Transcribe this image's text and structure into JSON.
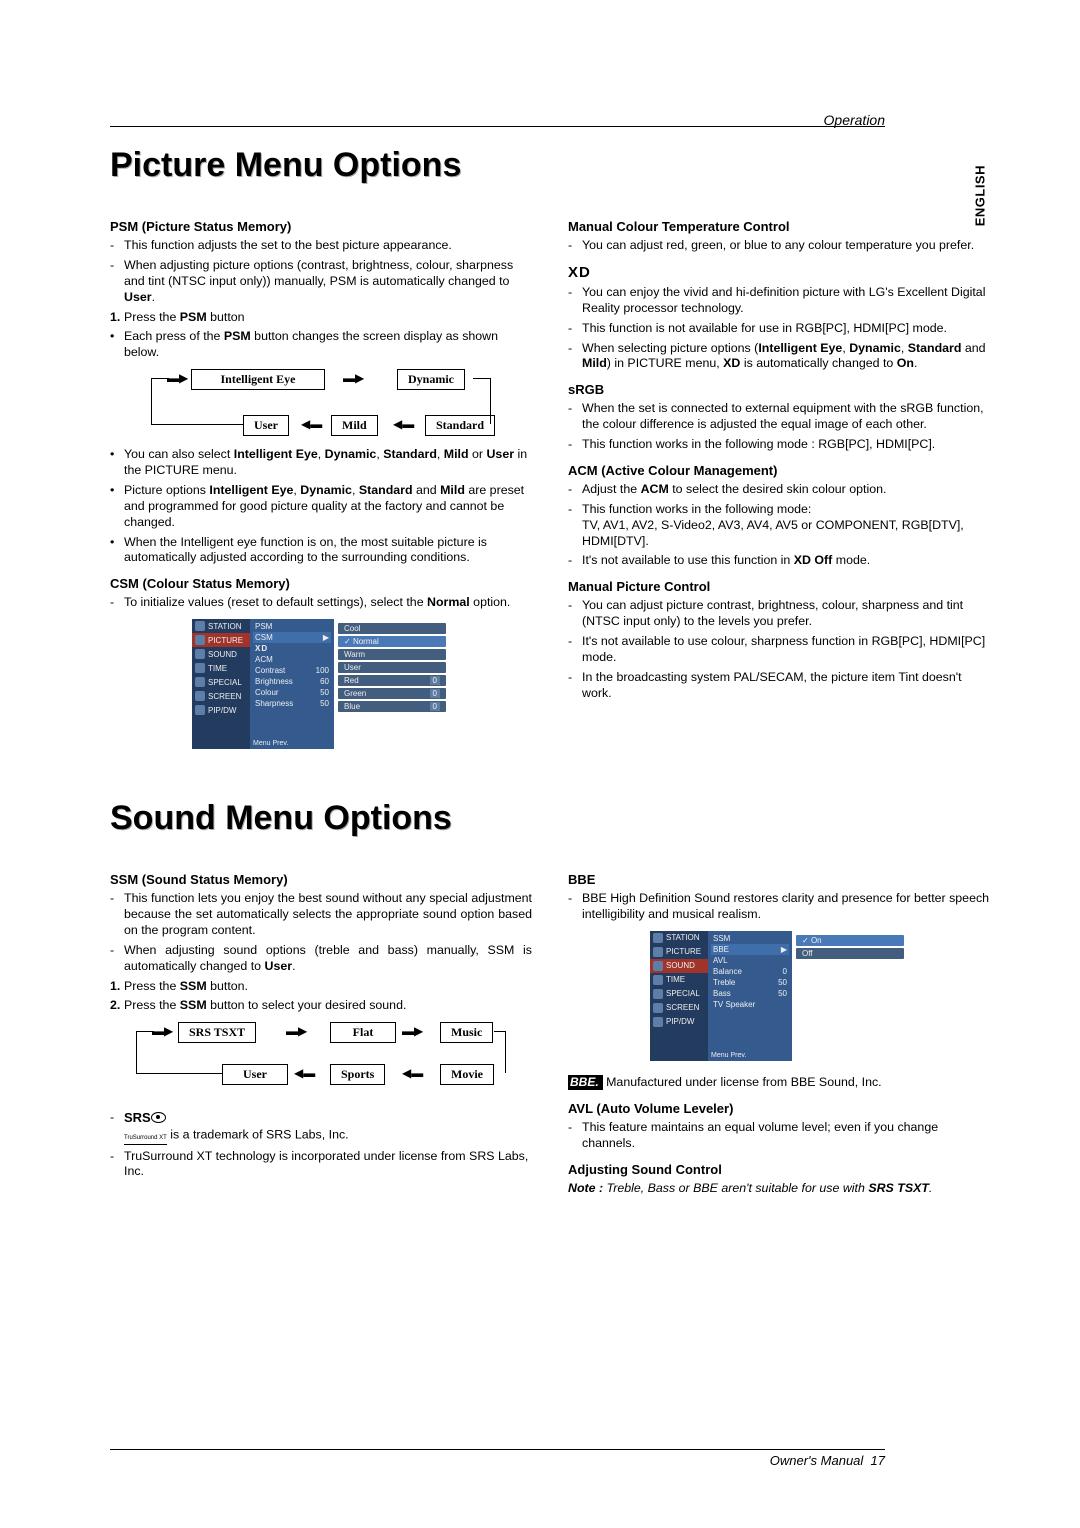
{
  "header": {
    "operation": "Operation",
    "lang": "ENGLISH"
  },
  "titles": {
    "picture": "Picture Menu Options",
    "sound": "Sound Menu Options"
  },
  "picture_left": {
    "psm_h": "PSM (Picture Status Memory)",
    "psm_b1": "This function adjusts the set to the best picture appearance.",
    "psm_b2a": "When adjusting picture options (contrast, brightness, colour, sharpness and tint (NTSC input only)) manually, PSM is automatically changed to ",
    "psm_b2b": "User",
    "psm_b2c": ".",
    "psm_step1a": "Press the ",
    "psm_step1b": "PSM",
    "psm_step1c": " button",
    "psm_step2a": "Each press of the ",
    "psm_step2b": "PSM",
    "psm_step2c": " button changes the screen display as shown below.",
    "psm_flow": {
      "a": "Intelligent Eye",
      "b": "Dynamic",
      "c": "Standard",
      "d": "Mild",
      "e": "User"
    },
    "psm_foot1a": "You can also select ",
    "psm_foot1b": "Intelligent Eye",
    "psm_foot1c": ", ",
    "psm_foot1d": "Dynamic",
    "psm_foot1e": ", ",
    "psm_foot1f": "Standard",
    "psm_foot1g": ", ",
    "psm_foot1h": "Mild",
    "psm_foot1i": " or ",
    "psm_foot1j": "User",
    "psm_foot1k": " in the PICTURE menu.",
    "psm_foot2a": "Picture options ",
    "psm_foot2b": "Intelligent Eye",
    "psm_foot2c": ", ",
    "psm_foot2d": "Dynamic",
    "psm_foot2e": ", ",
    "psm_foot2f": "Standard",
    "psm_foot2g": " and ",
    "psm_foot2h": "Mild",
    "psm_foot2i": " are preset and programmed for good picture quality at the factory and cannot be changed.",
    "psm_foot3": "When the Intelligent eye function is on, the most suitable picture is automatically adjusted according to the surrounding conditions.",
    "csm_h": "CSM (Colour Status Memory)",
    "csm_b1a": "To initialize values (reset to default settings), select the ",
    "csm_b1b": "Normal",
    "csm_b1c": " option.",
    "osd1_left": [
      "STATION",
      "PICTURE",
      "SOUND",
      "TIME",
      "SPECIAL",
      "SCREEN",
      "PIP/DW"
    ],
    "osd1_mid": [
      {
        "k": "PSM",
        "v": ""
      },
      {
        "k": "CSM",
        "v": "▶"
      },
      {
        "k": "XD",
        "v": ""
      },
      {
        "k": "ACM",
        "v": ""
      },
      {
        "k": "Contrast",
        "v": "100"
      },
      {
        "k": "Brightness",
        "v": "60"
      },
      {
        "k": "Colour",
        "v": "50"
      },
      {
        "k": "Sharpness",
        "v": "50"
      }
    ],
    "osd1_btm": "Menu  Prev.",
    "osd1_right": [
      {
        "t": "Cool",
        "v": ""
      },
      {
        "t": "Normal",
        "v": "✓"
      },
      {
        "t": "Warm",
        "v": ""
      },
      {
        "t": "User",
        "v": ""
      },
      {
        "t": "Red",
        "v": "0"
      },
      {
        "t": "Green",
        "v": "0"
      },
      {
        "t": "Blue",
        "v": "0"
      }
    ]
  },
  "picture_right": {
    "mcol_h": "Manual Colour Temperature Control",
    "mcol_b1": "You can adjust red, green, or blue to any colour temperature you prefer.",
    "xd_logo": "XD",
    "xd_b1": "You can enjoy the vivid and hi-definition picture with LG's Excellent Digital Reality processor technology.",
    "xd_b2": "This function is not available for use in RGB[PC], HDMI[PC] mode.",
    "xd_b3a": "When selecting picture options (",
    "xd_b3b": "Intelligent Eye",
    "xd_b3c": ", ",
    "xd_b3d": "Dynamic",
    "xd_b3e": ", ",
    "xd_b3f": "Standard",
    "xd_b3g": " and ",
    "xd_b3h": "Mild",
    "xd_b3i": ") in PICTURE menu, ",
    "xd_b3j": "XD",
    "xd_b3k": " is automatically changed to ",
    "xd_b3l": "On",
    "xd_b3m": ".",
    "srgb_h": "sRGB",
    "srgb_b1": "When the set is connected to external equipment with the sRGB function, the colour difference is adjusted the equal image of each other.",
    "srgb_b2": "This function works in the following mode : RGB[PC], HDMI[PC].",
    "acm_h": "ACM (Active Colour Management)",
    "acm_b1a": "Adjust the ",
    "acm_b1b": "ACM",
    "acm_b1c": " to select the desired skin colour option.",
    "acm_b2": "This function works in the following mode:",
    "acm_b2b": "TV, AV1, AV2, S-Video2, AV3, AV4, AV5 or COMPONENT, RGB[DTV], HDMI[DTV].",
    "acm_b3a": "It's not available to use this function in ",
    "acm_b3b": "XD Off",
    "acm_b3c": " mode.",
    "mpc_h": "Manual Picture Control",
    "mpc_b1": "You can adjust picture contrast, brightness, colour, sharpness and tint (NTSC input only) to the levels you prefer.",
    "mpc_b2": "It's not available to use colour, sharpness function in RGB[PC], HDMI[PC] mode.",
    "mpc_b3": "In the broadcasting system PAL/SECAM, the picture item Tint doesn't work."
  },
  "sound_left": {
    "ssm_h": "SSM (Sound Status Memory)",
    "ssm_b1": "This function lets you enjoy the best sound without any special adjustment because the set automatically selects the appropriate sound option based on the program content.",
    "ssm_b2a": "When adjusting sound options (treble and bass) manually, SSM is automatically changed to ",
    "ssm_b2b": "User",
    "ssm_b2c": ".",
    "ssm_s1a": "Press the ",
    "ssm_s1b": "SSM",
    "ssm_s1c": " button.",
    "ssm_s2a": "Press the ",
    "ssm_s2b": "SSM",
    "ssm_s2c": " button to select your desired sound.",
    "ssm_flow": {
      "a": "SRS TSXT",
      "b": "Flat",
      "c": "Music",
      "d": "Movie",
      "e": "Sports",
      "f": "User"
    },
    "srs_tm": " is a trademark of SRS Labs, Inc.",
    "srs_lic": "TruSurround XT technology is incorporated under license from SRS Labs, Inc.",
    "srs_logo_main": "SRS",
    "srs_logo_sub": "TruSurround XT"
  },
  "sound_right": {
    "bbe_h": "BBE",
    "bbe_b1": "BBE High Definition Sound restores clarity and presence for better speech intelligibility and musical realism.",
    "osd2_left": [
      "STATION",
      "PICTURE",
      "SOUND",
      "TIME",
      "SPECIAL",
      "SCREEN",
      "PIP/DW"
    ],
    "osd2_mid": [
      {
        "k": "SSM",
        "v": ""
      },
      {
        "k": "BBE",
        "v": "▶"
      },
      {
        "k": "AVL",
        "v": ""
      },
      {
        "k": "Balance",
        "v": "0"
      },
      {
        "k": "Treble",
        "v": "50"
      },
      {
        "k": "Bass",
        "v": "50"
      },
      {
        "k": "TV Speaker",
        "v": ""
      }
    ],
    "osd2_btm": "Menu  Prev.",
    "osd2_right": [
      {
        "t": "On",
        "v": "✓"
      },
      {
        "t": "Off",
        "v": ""
      }
    ],
    "bbe_logo": "BBE.",
    "bbe_lic": " Manufactured under license from BBE Sound, Inc.",
    "avl_h": "AVL (Auto Volume Leveler)",
    "avl_b1": "This feature maintains an equal volume level; even if you change channels.",
    "adj_h": "Adjusting Sound Control",
    "adj_note_a": "Note : ",
    "adj_note_b": "Treble, Bass or BBE aren't suitable for use with ",
    "adj_note_c": "SRS TSXT",
    "adj_note_d": "."
  },
  "footer": {
    "owners": "Owner's Manual",
    "pg": "17"
  }
}
